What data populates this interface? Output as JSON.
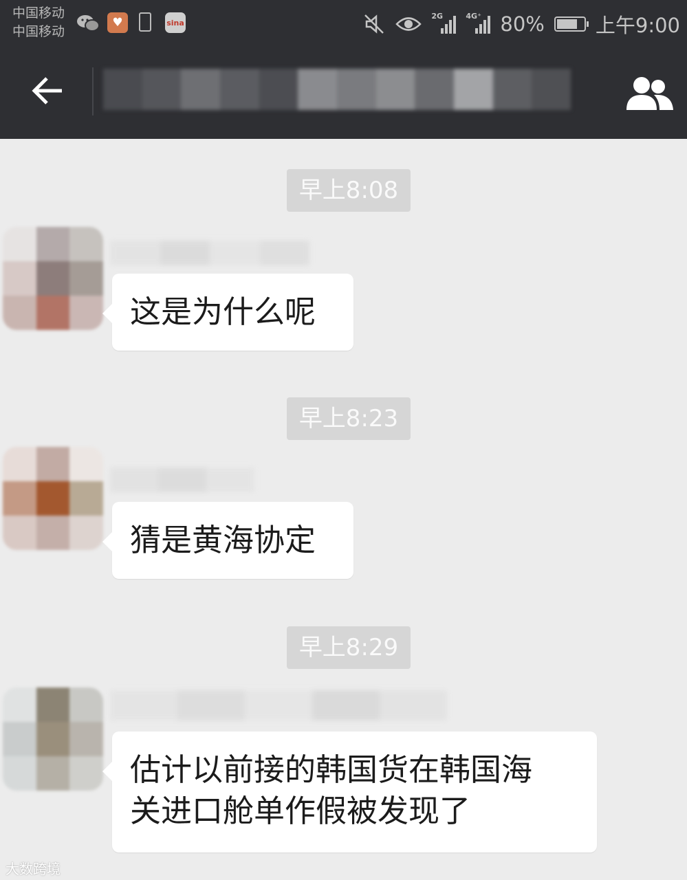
{
  "status_bar": {
    "carrier_1": "中国移动",
    "carrier_2": "中国移动",
    "network_2g": "2G",
    "network_4g": "4G⁺",
    "battery_percent": "80%",
    "battery_level": 0.8,
    "time": "上午9:00",
    "icons": [
      "wechat-icon",
      "heart-app-icon",
      "battery-saver-icon",
      "sina-weibo-icon",
      "mute-icon",
      "eye-care-icon",
      "signal-icon",
      "battery-icon"
    ]
  },
  "title_bar": {
    "back_icon": "arrow-left-icon",
    "members_icon": "group-members-icon",
    "title_blurred": true
  },
  "messages": [
    {
      "time": "早上8:08",
      "text": "这是为什么呢"
    },
    {
      "time": "早上8:23",
      "text": "猜是黄海协定"
    },
    {
      "time": "早上8:29",
      "line1": "估计以前接的韩国货在韩国海",
      "line2": "关进口舱单作假被发现了"
    }
  ],
  "watermark": "大数跨境",
  "colors": {
    "header_bg": "#2e2f33",
    "chat_bg": "#ececec",
    "bubble_bg": "#ffffff",
    "time_badge_bg": "#d6d6d6"
  }
}
